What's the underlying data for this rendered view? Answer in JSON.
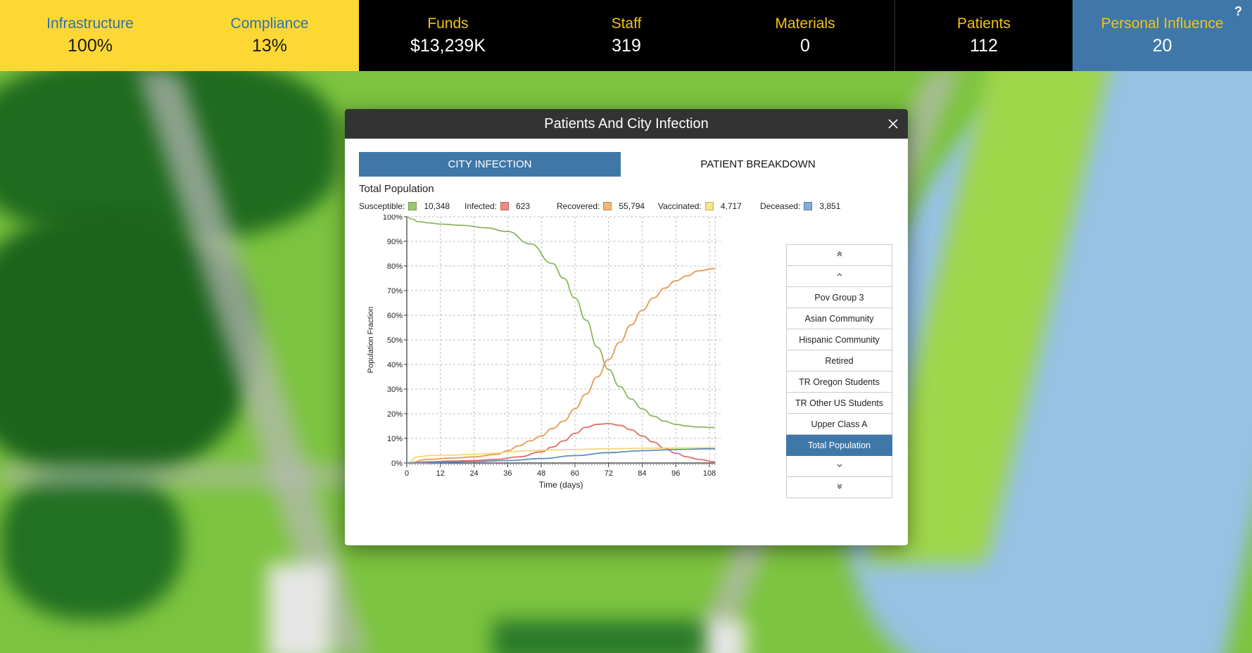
{
  "stats": [
    {
      "label": "Infrastructure",
      "value": "100%"
    },
    {
      "label": "Compliance",
      "value": "13%"
    },
    {
      "label": "Funds",
      "value": "$13,239K"
    },
    {
      "label": "Staff",
      "value": "319"
    },
    {
      "label": "Materials",
      "value": "0"
    },
    {
      "label": "Patients",
      "value": "112"
    },
    {
      "label": "Personal Influence",
      "value": "20"
    }
  ],
  "help_label": "?",
  "dialog": {
    "title": "Patients And City Infection",
    "close_glyph": "✕",
    "tabs": [
      {
        "label": "CITY INFECTION",
        "active": true
      },
      {
        "label": "PATIENT BREAKDOWN",
        "active": false
      }
    ],
    "chart_title": "Total Population",
    "legend": [
      {
        "label": "Susceptible:",
        "value": "10,348",
        "color": "#9cc86a"
      },
      {
        "label": "Infected:",
        "value": "623",
        "color": "#ef8a84"
      },
      {
        "label": "Recovered:",
        "value": "55,794",
        "color": "#f2b77a"
      },
      {
        "label": "Vaccinated:",
        "value": "4,717",
        "color": "#f8e58a"
      },
      {
        "label": "Deceased:",
        "value": "3,851",
        "color": "#7eaed6"
      }
    ],
    "groups": {
      "scroll_top": "⌃⌃",
      "scroll_up": "⌃",
      "scroll_down": "⌄",
      "scroll_bottom": "⌄⌄",
      "items": [
        "Pov Group 3",
        "Asian Community",
        "Hispanic Community",
        "Retired",
        "TR Oregon Students",
        "TR Other US Students",
        "Upper Class A",
        "Total Population"
      ],
      "selected": "Total Population"
    }
  },
  "chart_data": {
    "type": "line",
    "title": "Total Population",
    "xlabel": "Time (days)",
    "ylabel": "Population Fraction",
    "xlim": [
      0,
      112
    ],
    "ylim": [
      0,
      100
    ],
    "xticks": [
      0,
      12,
      24,
      36,
      48,
      60,
      72,
      84,
      96,
      108
    ],
    "yticks": [
      0,
      10,
      20,
      30,
      40,
      50,
      60,
      70,
      80,
      90,
      100
    ],
    "ytick_labels": [
      "0%",
      "10%",
      "20%",
      "30%",
      "40%",
      "50%",
      "60%",
      "70%",
      "80%",
      "90%",
      "100%"
    ],
    "grid": true,
    "series": [
      {
        "name": "Susceptible",
        "color": "#8db55f",
        "x": [
          0,
          2,
          4,
          8,
          12,
          20,
          28,
          36,
          44,
          52,
          56,
          60,
          64,
          68,
          72,
          76,
          80,
          84,
          88,
          92,
          96,
          100,
          104,
          110
        ],
        "y": [
          100,
          99,
          98,
          97.5,
          97,
          96.5,
          95.5,
          94,
          89,
          81,
          75,
          67,
          58,
          47,
          38,
          31,
          26,
          22,
          19,
          17,
          15.7,
          15,
          14.6,
          14.4
        ]
      },
      {
        "name": "Infected",
        "color": "#e06d66",
        "x": [
          0,
          8,
          16,
          24,
          32,
          40,
          48,
          52,
          56,
          60,
          64,
          68,
          72,
          76,
          80,
          84,
          88,
          92,
          96,
          100,
          104,
          110
        ],
        "y": [
          0,
          0.5,
          0.8,
          1,
          1.5,
          2.5,
          4.5,
          6.5,
          9,
          12,
          14.5,
          15.7,
          16,
          15.3,
          13.5,
          11,
          8.5,
          6,
          4,
          2.5,
          1.5,
          0.5
        ]
      },
      {
        "name": "Recovered",
        "color": "#e59a52",
        "x": [
          0,
          8,
          16,
          24,
          32,
          36,
          40,
          44,
          48,
          52,
          56,
          60,
          64,
          68,
          72,
          76,
          80,
          84,
          88,
          92,
          96,
          100,
          104,
          110
        ],
        "y": [
          0,
          1.5,
          2,
          2.5,
          3.5,
          5,
          7,
          9,
          11,
          14,
          17,
          22,
          28,
          35,
          42,
          49,
          56,
          62,
          67,
          71,
          74,
          76,
          78,
          79
        ]
      },
      {
        "name": "Vaccinated",
        "color": "#f2d776",
        "x": [
          0,
          4,
          8,
          16,
          24,
          32,
          36,
          44,
          52,
          60,
          72,
          84,
          96,
          110
        ],
        "y": [
          0,
          2.5,
          3,
          3.2,
          3.5,
          4,
          4.5,
          5,
          5.3,
          5.5,
          5.8,
          6,
          6.1,
          6.2
        ]
      },
      {
        "name": "Deceased",
        "color": "#5b8fbe",
        "x": [
          0,
          12,
          24,
          36,
          48,
          60,
          72,
          84,
          96,
          110
        ],
        "y": [
          0,
          0.3,
          0.6,
          1,
          1.8,
          3,
          4.2,
          5,
          5.5,
          5.8
        ]
      }
    ]
  }
}
